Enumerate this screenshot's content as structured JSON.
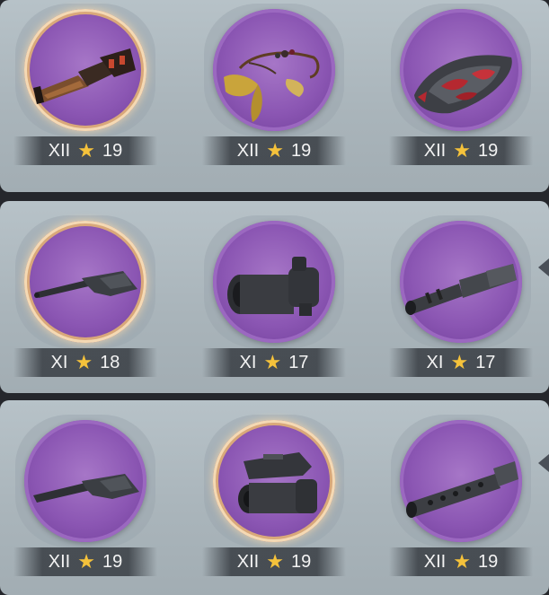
{
  "colors": {
    "disc": "#8b56b3",
    "star": "#f5c23b",
    "badge_text": "#f3f3f3",
    "panel": "#b0bbc1"
  },
  "rows": [
    {
      "items": [
        {
          "name": "Hammer Grip",
          "tier": "XII",
          "level": "19",
          "selected": true,
          "icon": "hammer-grip-icon"
        },
        {
          "name": "Tassel Charm",
          "tier": "XII",
          "level": "19",
          "selected": false,
          "icon": "tassel-charm-icon"
        },
        {
          "name": "Ornate Plate",
          "tier": "XII",
          "level": "19",
          "selected": false,
          "icon": "ornate-plate-icon"
        }
      ]
    },
    {
      "items": [
        {
          "name": "Stock",
          "tier": "XI",
          "level": "18",
          "selected": true,
          "icon": "rifle-stock-icon"
        },
        {
          "name": "Scope",
          "tier": "XI",
          "level": "17",
          "selected": false,
          "icon": "scope-icon"
        },
        {
          "name": "Muzzle",
          "tier": "XI",
          "level": "17",
          "selected": false,
          "icon": "muzzle-icon"
        }
      ]
    },
    {
      "items": [
        {
          "name": "Stock",
          "tier": "XII",
          "level": "19",
          "selected": false,
          "icon": "rifle-stock-icon"
        },
        {
          "name": "Sight",
          "tier": "XII",
          "level": "19",
          "selected": true,
          "icon": "sight-icon"
        },
        {
          "name": "Barrel",
          "tier": "XII",
          "level": "19",
          "selected": false,
          "icon": "perforated-barrel-icon"
        }
      ]
    }
  ]
}
